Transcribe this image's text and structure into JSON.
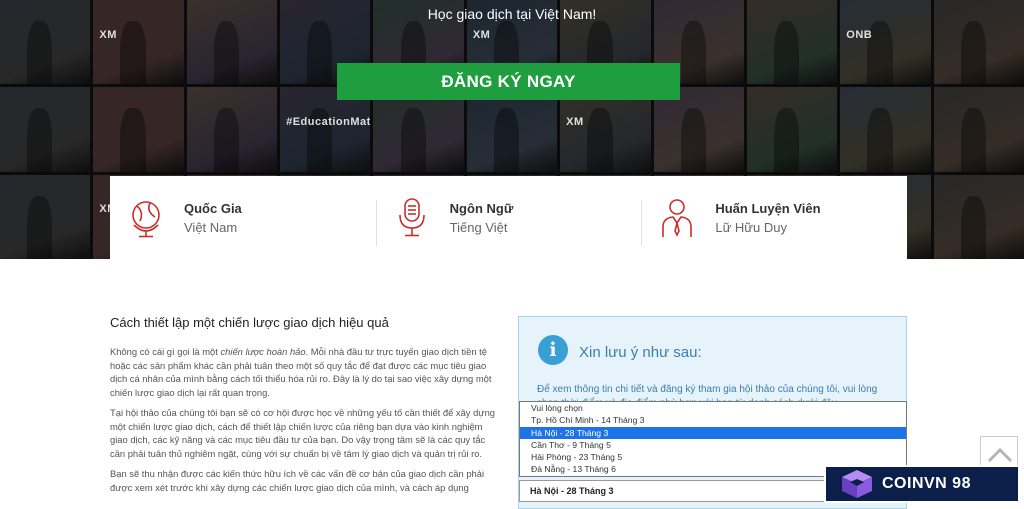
{
  "hero": {
    "tagline": "Học giao dịch tại Việt Nam!",
    "cta_label": "ĐĂNG KÝ NGAY",
    "tile_texts": [
      "XM",
      "XM",
      "ONB",
      "#EducationMatters",
      "XM",
      "XM"
    ]
  },
  "info": [
    {
      "icon": "globe-icon",
      "title": "Quốc Gia",
      "value": "Việt Nam"
    },
    {
      "icon": "microphone-icon",
      "title": "Ngôn Ngữ",
      "value": "Tiếng Việt"
    },
    {
      "icon": "person-icon",
      "title": "Huấn Luyện Viên",
      "value": "Lữ Hữu Duy"
    }
  ],
  "article": {
    "heading": "Cách thiết lập một chiến lược giao dịch hiệu quả",
    "p1_before": "Không có cái gì gọi là một ",
    "p1_em": "chiến lược hoàn hảo",
    "p1_after": ". Mỗi nhà đầu tư trực tuyến giao dịch tiền tệ hoặc các sản phẩm khác cần phải tuân theo một số quy tắc để đạt được các mục tiêu giao dịch cá nhân của mình bằng cách tối thiểu hóa rủi ro. Đây là lý do tại sao việc xây dựng một chiến lược giao dịch lại rất quan trọng.",
    "p2": "Tại hội thảo của chúng tôi bạn sẽ có cơ hội được học về những yếu tố cần thiết để xây dựng một chiến lược giao dịch, cách để thiết lập chiến lược của riêng bạn dựa vào kinh nghiệm giao dịch, các kỹ năng và các mục tiêu đầu tư của bạn. Do vậy trọng tâm sẽ là các quy tắc cần phải tuân thủ nghiêm ngặt, cùng với sự chuẩn bị về tâm lý giao dịch và quản trị rủi ro.",
    "p3": "Bạn sẽ thu nhận được các kiến thức hữu ích về các vấn đề cơ bản của giao dịch cần phải được xem xét trước khi xây dựng các chiến lược giao dịch của mình, và cách áp dụng"
  },
  "notice": {
    "title": "Xin lưu ý như sau:",
    "text": "Để xem thông tin chi tiết và đăng ký tham gia hội thảo của chúng tôi, vui lòng chọn thời điểm và địa điểm phù hợp với bạn từ danh sách dưới đây"
  },
  "select": {
    "options": [
      "Vui lòng chọn",
      "Tp. Hồ Chí Minh - 14 Tháng 3",
      "Hà Nội - 28 Tháng 3",
      "Cần Thơ - 9 Tháng 5",
      "Hải Phòng - 23 Tháng 5",
      "Đà Nẵng - 13 Tháng 6"
    ],
    "highlighted_index": 2,
    "selected_value": "Hà Nội - 28 Tháng 3"
  },
  "logo": {
    "text": "COINVN 98",
    "icon": "cube-logo-icon"
  },
  "scroll_top_icon": "chevron-up-icon",
  "colors": {
    "cta": "#1e9e3e",
    "notice_bg": "#e7f3fa",
    "notice_accent": "#3a9fd5",
    "icon_red": "#c9302c",
    "select_highlight": "#1e73e8",
    "logo_bg": "#0b1f4a"
  }
}
